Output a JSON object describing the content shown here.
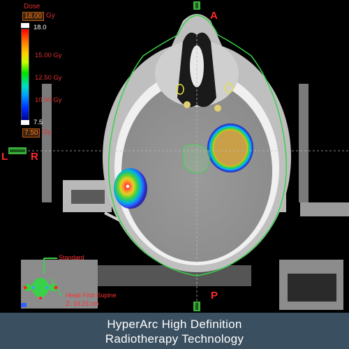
{
  "dose_panel": {
    "title": "Dose",
    "max_value": "18.00",
    "max_unit": "Gy",
    "scale_top": "18.0",
    "labels": [
      "15.00 Gy",
      "12.50 Gy",
      "10.00 Gy"
    ],
    "scale_bottom": "7.5",
    "min_value": "7.50",
    "min_unit": "Gy"
  },
  "orientation": {
    "anterior": "A",
    "posterior": "P",
    "left": "L",
    "right": "R"
  },
  "patient_position": {
    "view_label": "Standard",
    "orientation_label": "Head First-Supine",
    "coordinate_label": "Z: 10.23 cm"
  },
  "colors": {
    "target_outline": "#3ad14a",
    "dose_red": "#ff2020",
    "label_red": "#ff2a2a",
    "footer_bg": "#3a4f60"
  },
  "footer": {
    "line1": "HyperArc High Definition",
    "line2": "Radiotherapy Technology"
  }
}
